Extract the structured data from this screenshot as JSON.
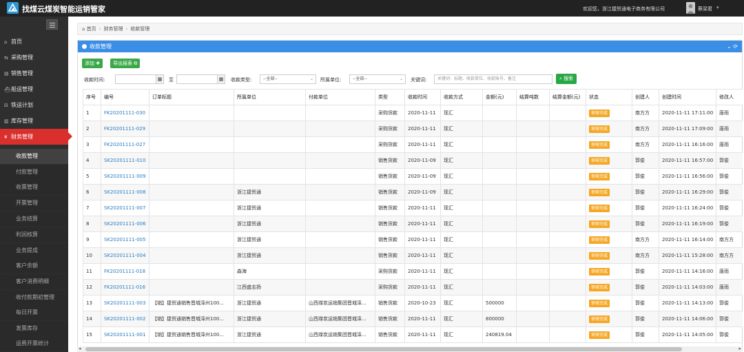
{
  "app": {
    "title": "找煤云煤炭智能运销管家",
    "welcome": "欢迎您，浙江捷贸通电子商务有限公司",
    "user_name": "蔡梁君",
    "user_caret": "▾"
  },
  "sidebar": {
    "items": [
      {
        "icon": "⌂",
        "label": "首页"
      },
      {
        "icon": "⇆",
        "label": "采购管理"
      },
      {
        "icon": "▤",
        "label": "销售管理"
      },
      {
        "icon": "⛴",
        "label": "船运管理"
      },
      {
        "icon": "⊟",
        "label": "铁运计划"
      },
      {
        "icon": "▥",
        "label": "库存管理"
      },
      {
        "icon": "¥",
        "label": "财务管理"
      }
    ],
    "sub_items": [
      "收款管理",
      "付款管理",
      "收票管理",
      "开票管理",
      "业务结算",
      "利润核算",
      "业务提成",
      "客户余额",
      "客户消费明细",
      "收付款期初管理",
      "每日开票",
      "发票库存",
      "运费开票统计"
    ]
  },
  "breadcrumb": {
    "home": "首页",
    "level1": "财务管理",
    "level2": "收款管理",
    "sep": "›"
  },
  "panel": {
    "title": "收款管理",
    "tools": "⌄ ⟳"
  },
  "toolbar": {
    "add_label": "添加 ✚",
    "export_label": "导出报表 ⧉"
  },
  "filters": {
    "date_label": "收款时间:",
    "to_label": "至",
    "cal_icon": "▦",
    "type_label": "收款类型:",
    "type_value": "--全部--",
    "unit_label": "所属单位:",
    "unit_value": "--全部--",
    "caret": "⌄",
    "keyword_label": "关键词:",
    "keyword_placeholder": "关键词：标题、收款单位、收款账号、备注",
    "search_label": "⌕ 搜索"
  },
  "table": {
    "headers": [
      "序号",
      "编号",
      "订单标题",
      "所属单位",
      "付款单位",
      "类型",
      "收款时间",
      "收款方式",
      "金额(元)",
      "结算吨数",
      "结算金额(元)",
      "状态",
      "创建人",
      "创建时间",
      "修改人"
    ],
    "rows": [
      [
        "1",
        "FK20201111-030",
        "",
        "",
        "",
        "采购货款",
        "2020-11-11",
        "现汇",
        "",
        "",
        "",
        "审核完成",
        "南方方",
        "2020-11-11 17:11:00",
        "唐雨"
      ],
      [
        "2",
        "FK20201111-029",
        "",
        "",
        "",
        "采购货款",
        "2020-11-11",
        "现汇",
        "",
        "",
        "",
        "审核完成",
        "南方方",
        "2020-11-11 17:09:00",
        "唐雨"
      ],
      [
        "3",
        "FK20201111-027",
        "",
        "",
        "",
        "采购货款",
        "2020-11-11",
        "现汇",
        "",
        "",
        "",
        "审核完成",
        "南方方",
        "2020-11-11 16:16:00",
        "唐雨"
      ],
      [
        "4",
        "SK20201111-010",
        "",
        "",
        "",
        "销售货款",
        "2020-11-09",
        "现汇",
        "",
        "",
        "",
        "审核完成",
        "郭俊",
        "2020-11-11 16:57:00",
        "郭俊"
      ],
      [
        "5",
        "SK20201111-009",
        "",
        "",
        "",
        "销售货款",
        "2020-11-09",
        "现汇",
        "",
        "",
        "",
        "审核完成",
        "郭俊",
        "2020-11-11 16:56:00",
        "郭俊"
      ],
      [
        "6",
        "SK20201111-008",
        "",
        "浙江捷贸通",
        "",
        "销售货款",
        "2020-11-09",
        "现汇",
        "",
        "",
        "",
        "审核完成",
        "郭俊",
        "2020-11-11 16:29:00",
        "郭俊"
      ],
      [
        "7",
        "SK20201111-007",
        "",
        "浙江捷贸通",
        "",
        "销售货款",
        "2020-11-11",
        "现汇",
        "",
        "",
        "",
        "审核完成",
        "郭俊",
        "2020-11-11 16:24:00",
        "郭俊"
      ],
      [
        "8",
        "SK20201111-006",
        "",
        "浙江捷贸通",
        "",
        "销售货款",
        "2020-11-11",
        "现汇",
        "",
        "",
        "",
        "审核完成",
        "郭俊",
        "2020-11-11 16:19:00",
        "郭俊"
      ],
      [
        "9",
        "SK20201111-005",
        "",
        "浙江捷贸通",
        "",
        "销售货款",
        "2020-11-11",
        "现汇",
        "",
        "",
        "",
        "审核完成",
        "南方方",
        "2020-11-11 16:14:00",
        "南方方"
      ],
      [
        "10",
        "SK20201111-004",
        "",
        "浙江捷贸通",
        "",
        "销售货款",
        "2020-11-11",
        "现汇",
        "",
        "",
        "",
        "审核完成",
        "南方方",
        "2020-11-11 15:28:00",
        "南方方"
      ],
      [
        "11",
        "FK20201111-018",
        "",
        "森海",
        "",
        "采购货款",
        "2020-11-11",
        "现汇",
        "",
        "",
        "",
        "审核完成",
        "郭俊",
        "2020-11-11 14:16:00",
        "唐雨"
      ],
      [
        "12",
        "FK20201111-016",
        "",
        "江西盛志扬",
        "",
        "采购货款",
        "2020-11-11",
        "现汇",
        "",
        "",
        "",
        "审核完成",
        "郭俊",
        "2020-11-11 14:03:00",
        "唐雨"
      ],
      [
        "13",
        "SK20201111-003",
        "【销】捷贸通销售晋城泽州100...",
        "浙江捷贸通",
        "山西煤炭运销集团晋城泽...",
        "销售货款",
        "2020-10-23",
        "现汇",
        "500000",
        "",
        "",
        "审核完成",
        "郭俊",
        "2020-11-11 14:13:00",
        "郭俊"
      ],
      [
        "14",
        "SK20201111-002",
        "【销】捷贸通销售晋城泽州100...",
        "浙江捷贸通",
        "山西煤炭运销集团晋城泽...",
        "销售货款",
        "2020-11-11",
        "现汇",
        "800000",
        "",
        "",
        "审核完成",
        "郭俊",
        "2020-11-11 14:06:00",
        "郭俊"
      ],
      [
        "15",
        "SK20201111-001",
        "【销】捷贸通销售晋城泽州100...",
        "浙江捷贸通",
        "山西煤炭运销集团晋城泽...",
        "销售货款",
        "2020-11-11",
        "现汇",
        "240819.04",
        "",
        "",
        "审核完成",
        "郭俊",
        "2020-11-11 14:05:00",
        "郭俊"
      ]
    ]
  },
  "scrollbar": {
    "left_arrow": "◂",
    "right_arrow": "▸"
  },
  "colors": {
    "brand": "#2a97d6",
    "active": "#d9302e",
    "panel_header": "#3a8ee6",
    "badge": "#f5a623",
    "link": "#2a7bbf",
    "green": "#3aa848"
  }
}
